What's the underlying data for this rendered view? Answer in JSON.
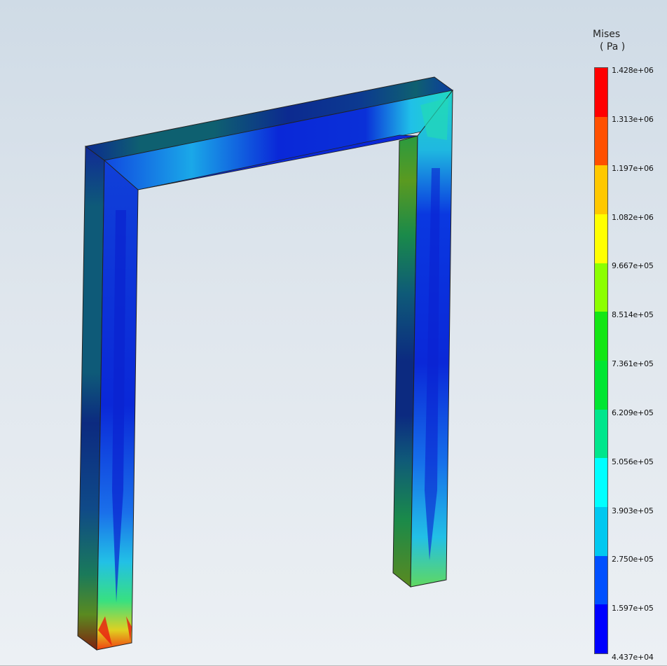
{
  "legend": {
    "title": "Mises",
    "unit": "( Pa )",
    "ticks": [
      "1.428e+06",
      "1.313e+06",
      "1.197e+06",
      "1.082e+06",
      "9.667e+05",
      "8.514e+05",
      "7.361e+05",
      "6.209e+05",
      "5.056e+05",
      "3.903e+05",
      "2.750e+05",
      "1.597e+05",
      "4.437e+04"
    ],
    "colors": [
      "#ff0000",
      "#ff5000",
      "#ffc800",
      "#ffff00",
      "#8cff00",
      "#14e614",
      "#00e632",
      "#00e68c",
      "#00ffff",
      "#00c8f0",
      "#0050ff",
      "#0000ff"
    ]
  }
}
